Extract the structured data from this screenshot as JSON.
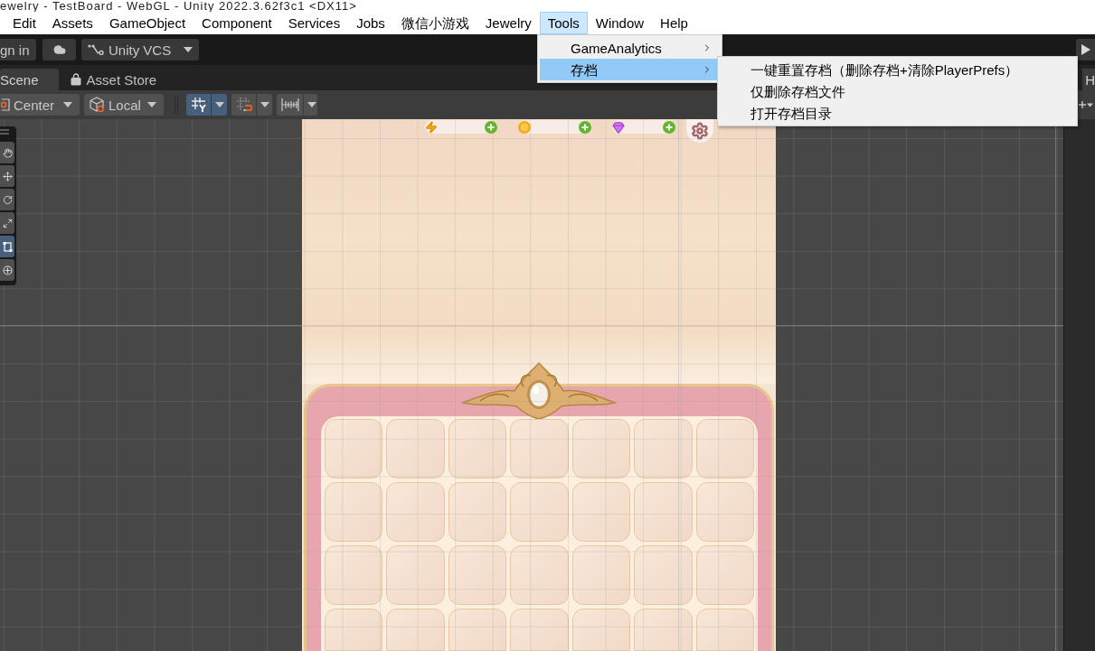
{
  "window": {
    "title": "ewelry - TestBoard - WebGL - Unity 2022.3.62f3c1 <DX11>"
  },
  "menu_bar": [
    {
      "label": "Edit",
      "selected": false
    },
    {
      "label": "Assets",
      "selected": false
    },
    {
      "label": "GameObject",
      "selected": false
    },
    {
      "label": "Component",
      "selected": false
    },
    {
      "label": "Services",
      "selected": false
    },
    {
      "label": "Jobs",
      "selected": false
    },
    {
      "label": "微信小游戏",
      "selected": false
    },
    {
      "label": "Jewelry",
      "selected": false
    },
    {
      "label": "Tools",
      "selected": true
    },
    {
      "label": "Window",
      "selected": false
    },
    {
      "label": "Help",
      "selected": false
    }
  ],
  "tools_menu": [
    {
      "label": "GameAnalytics",
      "selected": false,
      "has_submenu": true
    },
    {
      "label": "存档",
      "selected": true,
      "has_submenu": true
    }
  ],
  "submenu": [
    "一键重置存档（删除存档+清除PlayerPrefs）",
    "仅删除存档文件",
    "打开存档目录"
  ],
  "main_toolbar": {
    "account_button": "gn in",
    "version_control": "Unity VCS"
  },
  "tabs": [
    {
      "label": "Scene",
      "selected": true
    },
    {
      "label": "Asset Store",
      "selected": false
    }
  ],
  "scene_toolbar": {
    "pivot_mode": "Center",
    "pivot_rotation": "Local",
    "toggles": [
      {
        "kind": "grid",
        "selected": true
      },
      {
        "kind": "snap",
        "selected": false
      },
      {
        "kind": "increment",
        "selected": false
      }
    ]
  },
  "tool_palette": [
    {
      "kind": "view",
      "selected": false
    },
    {
      "kind": "move",
      "selected": false
    },
    {
      "kind": "rotate",
      "selected": false
    },
    {
      "kind": "scale",
      "selected": false
    },
    {
      "kind": "rect",
      "selected": true
    },
    {
      "kind": "transform",
      "selected": false
    }
  ],
  "hierarchy": {
    "tab": "H"
  }
}
